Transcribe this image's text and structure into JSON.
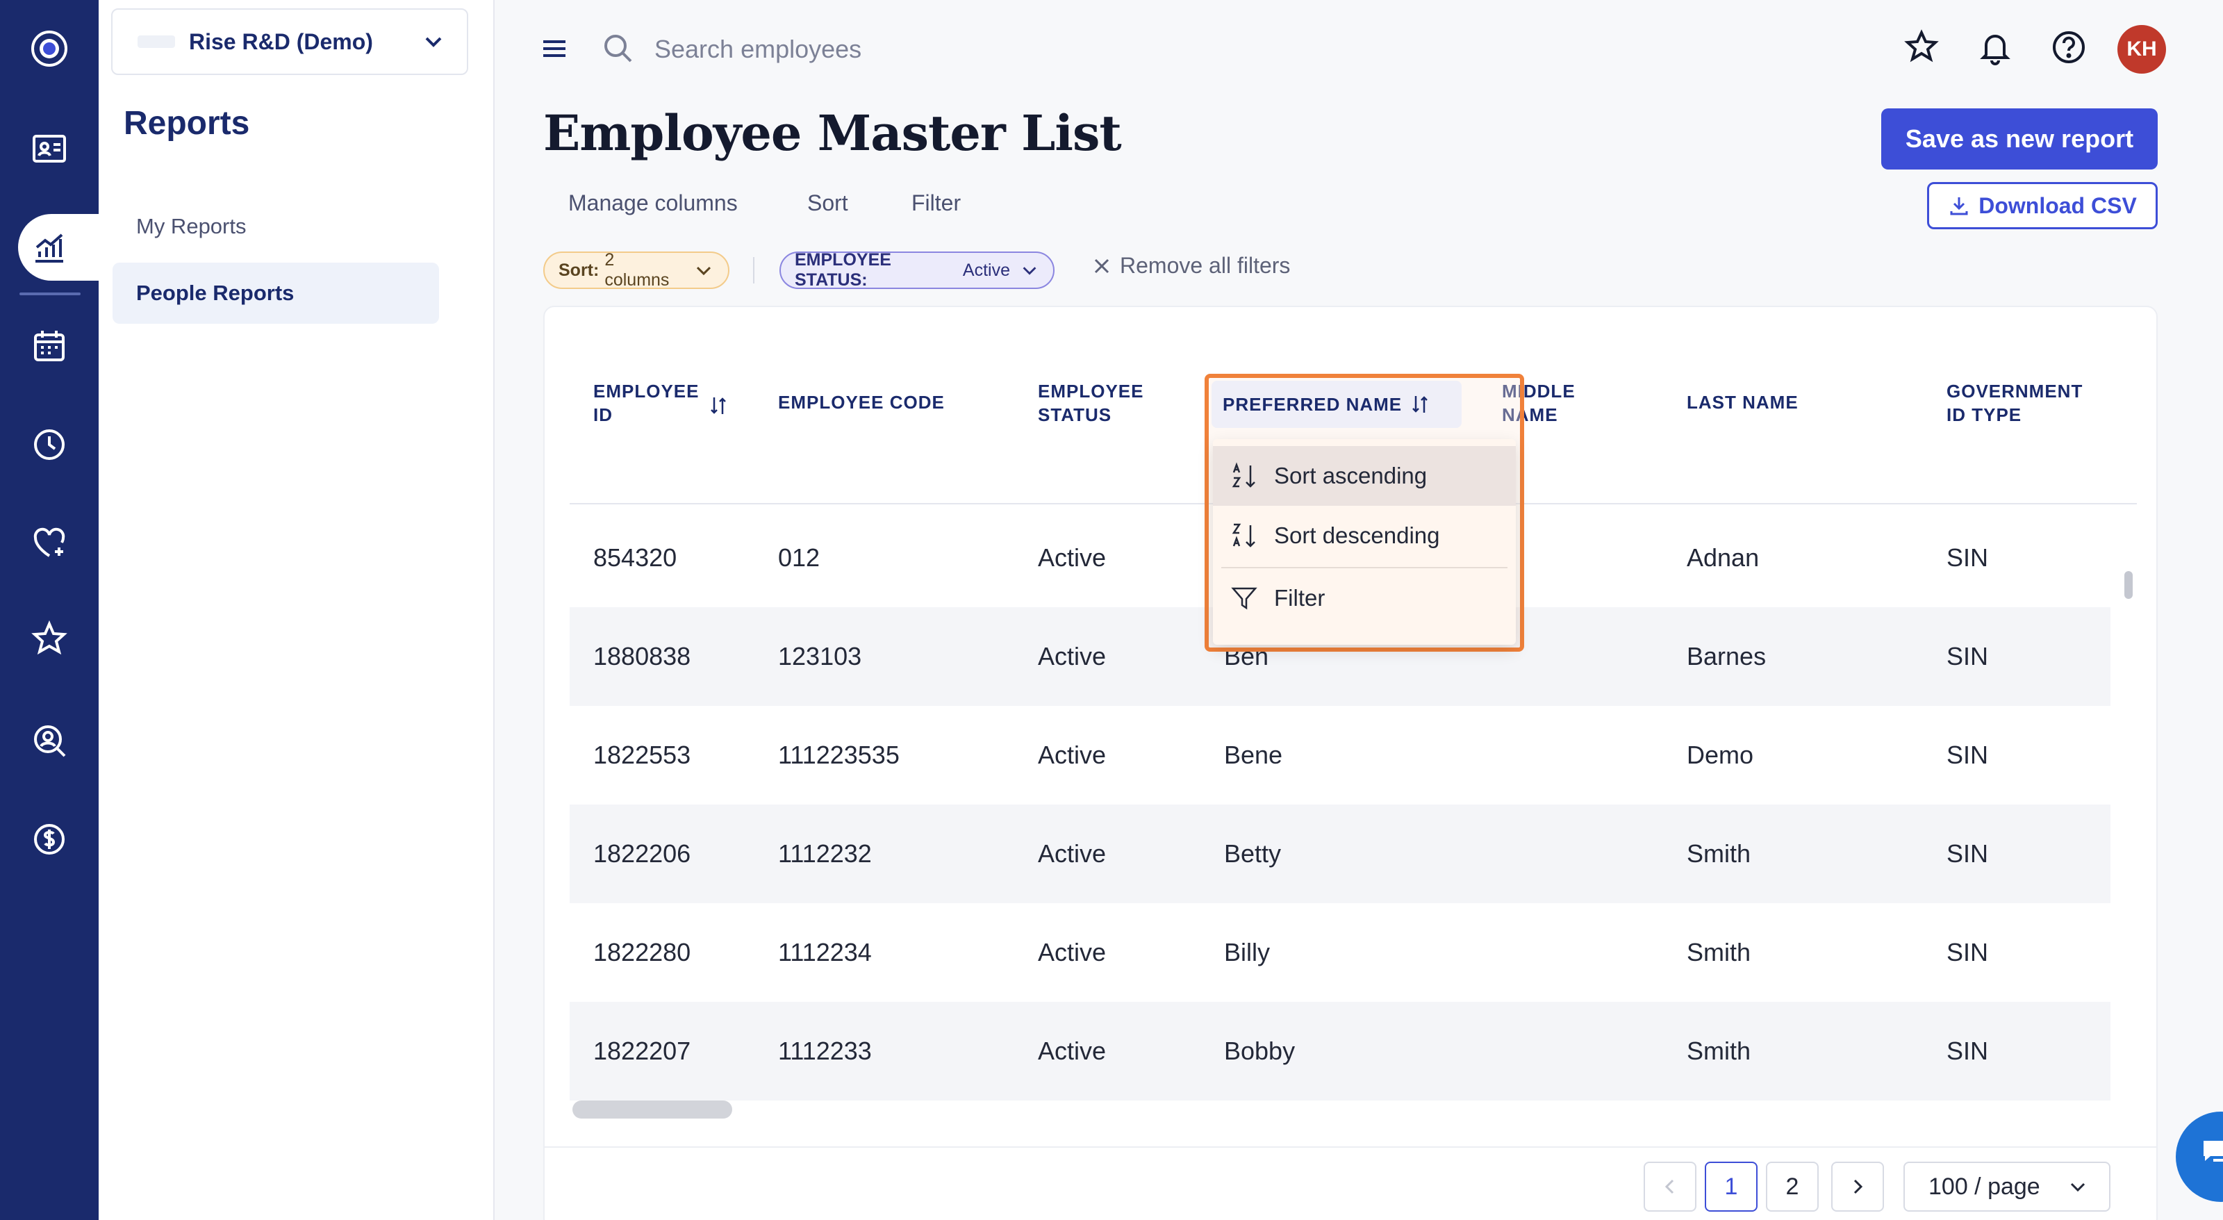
{
  "org": {
    "name": "Rise R&D (Demo)"
  },
  "sidebar": {
    "title": "Reports",
    "items": [
      {
        "label": "My Reports"
      },
      {
        "label": "People Reports"
      }
    ]
  },
  "topbar": {
    "search_placeholder": "Search employees",
    "avatar_initials": "KH"
  },
  "page": {
    "title": "Employee Master List",
    "save_label": "Save as new report",
    "download_label": "Download CSV",
    "toolbar": {
      "manage_columns": "Manage columns",
      "sort": "Sort",
      "filter": "Filter"
    },
    "chips": {
      "sort_key": "Sort:",
      "sort_value": "2 columns",
      "status_key": "EMPLOYEE STATUS:",
      "status_value": "Active",
      "remove_all": "Remove all filters"
    }
  },
  "table": {
    "headers": {
      "employee_id_1": "EMPLOYEE",
      "employee_id_2": "ID",
      "employee_code": "EMPLOYEE CODE",
      "employee_status_1": "EMPLOYEE",
      "employee_status_2": "STATUS",
      "preferred_name": "PREFERRED NAME",
      "middle_name_1": "MIDDLE",
      "middle_name_2": "NAME",
      "last_name": "LAST NAME",
      "gov_id_1": "GOVERNMENT",
      "gov_id_2": "ID TYPE"
    },
    "rows": [
      {
        "id": "854320",
        "code": "012",
        "status": "Active",
        "preferred": "",
        "last": "Adnan",
        "gov": "SIN"
      },
      {
        "id": "1880838",
        "code": "123103",
        "status": "Active",
        "preferred": "Ben",
        "last": "Barnes",
        "gov": "SIN"
      },
      {
        "id": "1822553",
        "code": "111223535",
        "status": "Active",
        "preferred": "Bene",
        "last": "Demo",
        "gov": "SIN"
      },
      {
        "id": "1822206",
        "code": "1112232",
        "status": "Active",
        "preferred": "Betty",
        "last": "Smith",
        "gov": "SIN"
      },
      {
        "id": "1822280",
        "code": "1112234",
        "status": "Active",
        "preferred": "Billy",
        "last": "Smith",
        "gov": "SIN"
      },
      {
        "id": "1822207",
        "code": "1112233",
        "status": "Active",
        "preferred": "Bobby",
        "last": "Smith",
        "gov": "SIN"
      }
    ]
  },
  "column_menu": {
    "sort_ascending": "Sort ascending",
    "sort_descending": "Sort descending",
    "filter": "Filter"
  },
  "pagination": {
    "page1": "1",
    "page2": "2",
    "page_size": "100 / page"
  },
  "colors": {
    "brand": "#1a2a6c",
    "primary": "#3d4ed7",
    "highlight": "#f0813a",
    "avatar": "#c0392b"
  }
}
